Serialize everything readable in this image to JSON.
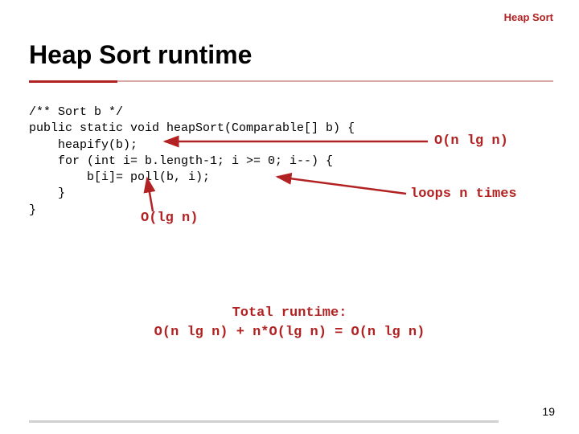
{
  "header": {
    "label": "Heap Sort"
  },
  "title": "Heap Sort runtime",
  "code": {
    "l1": "/** Sort b */",
    "l2": "public static void heapSort(Comparable[] b) {",
    "l3": "    heapify(b);",
    "l4": "    for (int i= b.length-1; i >= 0; i--) {",
    "l5": "        b[i]= poll(b, i);",
    "l6": "    }",
    "l7": "}"
  },
  "annotations": {
    "heapify": "O(n lg n)",
    "loops": "loops n times",
    "olgn": "O(lg n)"
  },
  "total": {
    "line1": "Total runtime:",
    "line2": "O(n lg n) + n*O(lg n) = O(n lg n)"
  },
  "page_number": "19"
}
